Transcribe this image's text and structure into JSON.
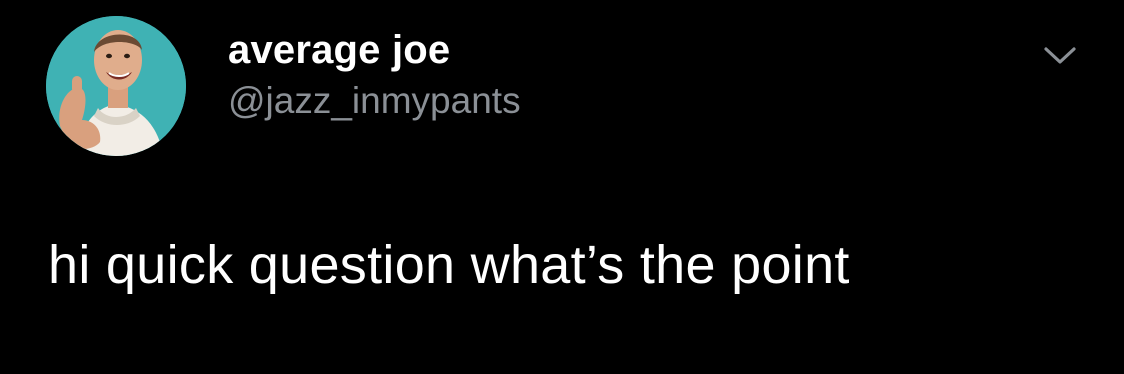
{
  "tweet": {
    "display_name": "average joe",
    "handle": "@jazz_inmypants",
    "text": "hi quick question what’s the point",
    "avatar_icon": "profile-photo-avatar",
    "menu_icon": "chevron-down-icon"
  },
  "colors": {
    "background": "#000000",
    "name": "#ffffff",
    "handle": "#8b9096",
    "text": "#ffffff",
    "avatar_bg": "#3fb2b4"
  }
}
